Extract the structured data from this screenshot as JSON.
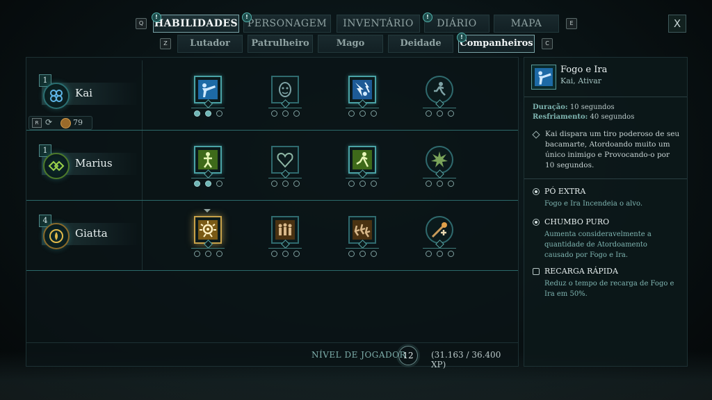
{
  "nav": {
    "key_left": "Q",
    "key_right": "E",
    "tabs": [
      {
        "label": "HABILIDADES",
        "active": true,
        "alert": true
      },
      {
        "label": "PERSONAGEM",
        "active": false,
        "alert": true
      },
      {
        "label": "INVENTÁRIO",
        "active": false,
        "alert": false
      },
      {
        "label": "DIÁRIO",
        "active": false,
        "alert": true
      },
      {
        "label": "MAPA",
        "active": false,
        "alert": false
      }
    ],
    "close_label": "X",
    "alert_glyph": "!"
  },
  "subnav": {
    "key_left": "Z",
    "key_right": "C",
    "tabs": [
      {
        "label": "Lutador",
        "active": false
      },
      {
        "label": "Patrulheiro",
        "active": false
      },
      {
        "label": "Mago",
        "active": false
      },
      {
        "label": "Deidade",
        "active": false
      },
      {
        "label": "Companheiros",
        "active": true,
        "alert": true
      }
    ]
  },
  "companions": [
    {
      "level": "1",
      "name": "Kai",
      "color": "#4fa6d8",
      "respec": {
        "key": "R",
        "cost": "79"
      },
      "skills": [
        {
          "icon": "blunderbuss-shot-icon",
          "active": true,
          "pips": [
            true,
            true,
            false
          ]
        },
        {
          "icon": "mask-icon",
          "active": false,
          "pips": [
            false,
            false,
            false
          ]
        },
        {
          "icon": "lightning-strike-icon",
          "active": true,
          "pips": [
            false,
            false,
            false
          ]
        },
        {
          "icon": "running-figure-icon",
          "active": false,
          "pips": [
            false,
            false,
            false
          ]
        }
      ]
    },
    {
      "level": "1",
      "name": "Marius",
      "color": "#8ec23a",
      "skills": [
        {
          "icon": "roots-figure-icon",
          "active": true,
          "pips": [
            true,
            true,
            false
          ]
        },
        {
          "icon": "heart-shield-icon",
          "active": false,
          "pips": [
            false,
            false,
            false
          ]
        },
        {
          "icon": "dash-figure-icon",
          "active": true,
          "pips": [
            false,
            false,
            false
          ]
        },
        {
          "icon": "burst-star-icon",
          "active": false,
          "pips": [
            false,
            false,
            false
          ]
        }
      ]
    },
    {
      "level": "4",
      "name": "Giatta",
      "color": "#d6b24a",
      "skills": [
        {
          "icon": "radiant-eye-icon",
          "active": true,
          "selected": true,
          "pips": [
            false,
            false,
            false
          ]
        },
        {
          "icon": "group-figures-icon",
          "active": false,
          "pips": [
            false,
            false,
            false
          ]
        },
        {
          "icon": "party-charge-icon",
          "active": false,
          "pips": [
            false,
            false,
            false
          ]
        },
        {
          "icon": "healing-staff-icon",
          "active": false,
          "pips": [
            false,
            false,
            false
          ]
        }
      ]
    }
  ],
  "footer": {
    "label": "NÍVEL DE JOGADOR",
    "level": "12",
    "xp": "(31.163 / 36.400 XP)"
  },
  "detail": {
    "title": "Fogo e Ira",
    "subtitle": "Kai, Ativar",
    "duration_label": "Duração:",
    "duration_value": "10 segundos",
    "cooldown_label": "Resfriamento:",
    "cooldown_value": "40 segundos",
    "description": "Kai dispara um tiro poderoso de seu bacamarte, Atordoando muito um único inimigo e Provocando-o por 10 segundos.",
    "upgrades": [
      {
        "name": "PÓ EXTRA",
        "desc": "Fogo e Ira Incendeia o alvo.",
        "state": "on"
      },
      {
        "name": "CHUMBO PURO",
        "desc": "Aumenta consideravelmente a quantidade de Atordoamento causado por Fogo e Ira.",
        "state": "on"
      },
      {
        "name": "RECARGA RÁPIDA",
        "desc": "Reduz o tempo de recarga de Fogo e Ira em 50%.",
        "state": "off"
      }
    ]
  }
}
